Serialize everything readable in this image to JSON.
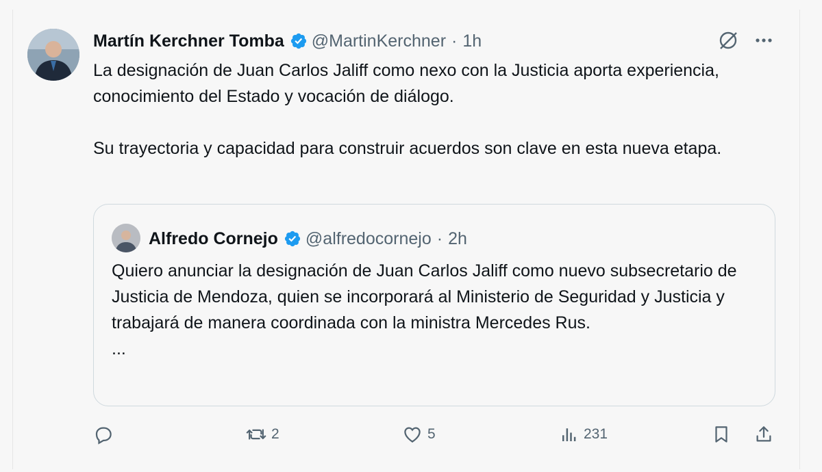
{
  "tweet": {
    "author_name": "Martín Kerchner Tomba",
    "handle": "@MartinKerchner",
    "separator": "·",
    "time": "1h",
    "text": "La designación de Juan Carlos Jaliff como nexo con la Justicia aporta experiencia, conocimiento del Estado y vocación de diálogo.\n\nSu trayectoria y capacidad para construir acuerdos son clave en esta nueva etapa.",
    "more_label": "···"
  },
  "quoted": {
    "author_name": "Alfredo Cornejo",
    "handle": "@alfredocornejo",
    "separator": "·",
    "time": "2h",
    "text": "Quiero anunciar la designación de Juan Carlos Jaliff como nuevo subsecretario de Justicia de Mendoza, quien se incorporará al Ministerio de Seguridad y Justicia y trabajará de manera coordinada con la ministra Mercedes Rus.\n...",
    "colors": {
      "verified": "#1d9bf0"
    }
  },
  "actions": {
    "reply_count": "",
    "retweet_count": "2",
    "like_count": "5",
    "views_count": "231"
  },
  "icons": [
    "verified-badge-icon",
    "grok-icon",
    "more-icon",
    "reply-icon",
    "retweet-icon",
    "like-icon",
    "views-icon",
    "bookmark-icon",
    "share-icon"
  ],
  "colors": {
    "text": "#0f1419",
    "muted": "#536471",
    "verified": "#1d9bf0",
    "border": "#cfd9de"
  }
}
